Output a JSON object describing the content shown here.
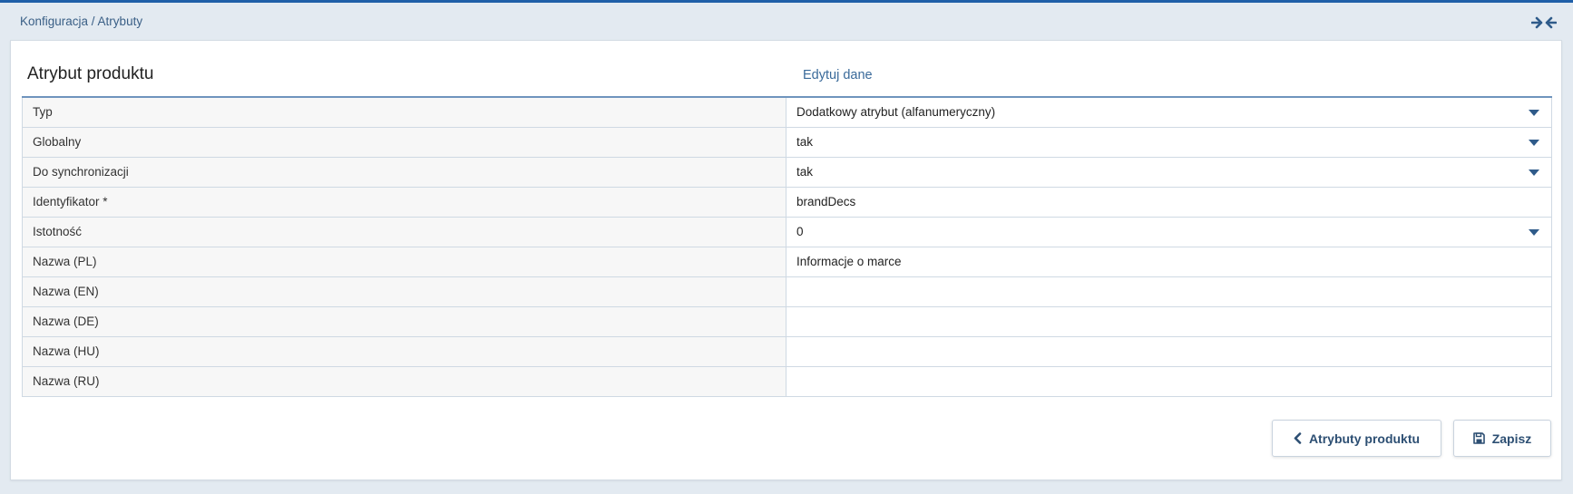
{
  "breadcrumb": "Konfiguracja / Atrybuty",
  "panel": {
    "title": "Atrybut produktu",
    "subtitle": "Edytuj dane"
  },
  "fields": [
    {
      "label": "Typ",
      "value": "Dodatkowy atrybut (alfanumeryczny)",
      "dropdown": true
    },
    {
      "label": "Globalny",
      "value": "tak",
      "dropdown": true
    },
    {
      "label": "Do synchronizacji",
      "value": "tak",
      "dropdown": true
    },
    {
      "label": "Identyfikator *",
      "value": "brandDecs",
      "dropdown": false
    },
    {
      "label": "Istotność",
      "value": "0",
      "dropdown": true
    },
    {
      "label": "Nazwa (PL)",
      "value": "Informacje o marce",
      "dropdown": false
    },
    {
      "label": "Nazwa (EN)",
      "value": "",
      "dropdown": false
    },
    {
      "label": "Nazwa (DE)",
      "value": "",
      "dropdown": false
    },
    {
      "label": "Nazwa (HU)",
      "value": "",
      "dropdown": false
    },
    {
      "label": "Nazwa (RU)",
      "value": "",
      "dropdown": false
    }
  ],
  "buttons": {
    "back_label": "Atrybuty produktu",
    "save_label": "Zapisz"
  },
  "colors": {
    "accent": "#1f5fa8",
    "link": "#3a6a9a",
    "button_text": "#2d4f73"
  },
  "icons": {
    "collapse": "collapse-arrows-icon",
    "back": "chevron-left-icon",
    "save": "floppy-disk-icon",
    "dropdown": "caret-down-icon"
  }
}
